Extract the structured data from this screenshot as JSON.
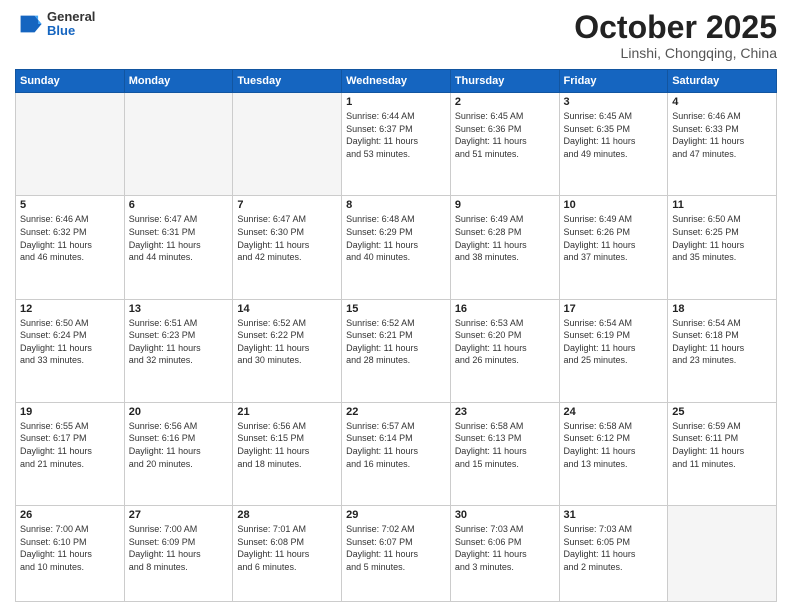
{
  "header": {
    "logo_general": "General",
    "logo_blue": "Blue",
    "month_title": "October 2025",
    "location": "Linshi, Chongqing, China"
  },
  "weekdays": [
    "Sunday",
    "Monday",
    "Tuesday",
    "Wednesday",
    "Thursday",
    "Friday",
    "Saturday"
  ],
  "weeks": [
    [
      {
        "day": "",
        "info": ""
      },
      {
        "day": "",
        "info": ""
      },
      {
        "day": "",
        "info": ""
      },
      {
        "day": "1",
        "info": "Sunrise: 6:44 AM\nSunset: 6:37 PM\nDaylight: 11 hours\nand 53 minutes."
      },
      {
        "day": "2",
        "info": "Sunrise: 6:45 AM\nSunset: 6:36 PM\nDaylight: 11 hours\nand 51 minutes."
      },
      {
        "day": "3",
        "info": "Sunrise: 6:45 AM\nSunset: 6:35 PM\nDaylight: 11 hours\nand 49 minutes."
      },
      {
        "day": "4",
        "info": "Sunrise: 6:46 AM\nSunset: 6:33 PM\nDaylight: 11 hours\nand 47 minutes."
      }
    ],
    [
      {
        "day": "5",
        "info": "Sunrise: 6:46 AM\nSunset: 6:32 PM\nDaylight: 11 hours\nand 46 minutes."
      },
      {
        "day": "6",
        "info": "Sunrise: 6:47 AM\nSunset: 6:31 PM\nDaylight: 11 hours\nand 44 minutes."
      },
      {
        "day": "7",
        "info": "Sunrise: 6:47 AM\nSunset: 6:30 PM\nDaylight: 11 hours\nand 42 minutes."
      },
      {
        "day": "8",
        "info": "Sunrise: 6:48 AM\nSunset: 6:29 PM\nDaylight: 11 hours\nand 40 minutes."
      },
      {
        "day": "9",
        "info": "Sunrise: 6:49 AM\nSunset: 6:28 PM\nDaylight: 11 hours\nand 38 minutes."
      },
      {
        "day": "10",
        "info": "Sunrise: 6:49 AM\nSunset: 6:26 PM\nDaylight: 11 hours\nand 37 minutes."
      },
      {
        "day": "11",
        "info": "Sunrise: 6:50 AM\nSunset: 6:25 PM\nDaylight: 11 hours\nand 35 minutes."
      }
    ],
    [
      {
        "day": "12",
        "info": "Sunrise: 6:50 AM\nSunset: 6:24 PM\nDaylight: 11 hours\nand 33 minutes."
      },
      {
        "day": "13",
        "info": "Sunrise: 6:51 AM\nSunset: 6:23 PM\nDaylight: 11 hours\nand 32 minutes."
      },
      {
        "day": "14",
        "info": "Sunrise: 6:52 AM\nSunset: 6:22 PM\nDaylight: 11 hours\nand 30 minutes."
      },
      {
        "day": "15",
        "info": "Sunrise: 6:52 AM\nSunset: 6:21 PM\nDaylight: 11 hours\nand 28 minutes."
      },
      {
        "day": "16",
        "info": "Sunrise: 6:53 AM\nSunset: 6:20 PM\nDaylight: 11 hours\nand 26 minutes."
      },
      {
        "day": "17",
        "info": "Sunrise: 6:54 AM\nSunset: 6:19 PM\nDaylight: 11 hours\nand 25 minutes."
      },
      {
        "day": "18",
        "info": "Sunrise: 6:54 AM\nSunset: 6:18 PM\nDaylight: 11 hours\nand 23 minutes."
      }
    ],
    [
      {
        "day": "19",
        "info": "Sunrise: 6:55 AM\nSunset: 6:17 PM\nDaylight: 11 hours\nand 21 minutes."
      },
      {
        "day": "20",
        "info": "Sunrise: 6:56 AM\nSunset: 6:16 PM\nDaylight: 11 hours\nand 20 minutes."
      },
      {
        "day": "21",
        "info": "Sunrise: 6:56 AM\nSunset: 6:15 PM\nDaylight: 11 hours\nand 18 minutes."
      },
      {
        "day": "22",
        "info": "Sunrise: 6:57 AM\nSunset: 6:14 PM\nDaylight: 11 hours\nand 16 minutes."
      },
      {
        "day": "23",
        "info": "Sunrise: 6:58 AM\nSunset: 6:13 PM\nDaylight: 11 hours\nand 15 minutes."
      },
      {
        "day": "24",
        "info": "Sunrise: 6:58 AM\nSunset: 6:12 PM\nDaylight: 11 hours\nand 13 minutes."
      },
      {
        "day": "25",
        "info": "Sunrise: 6:59 AM\nSunset: 6:11 PM\nDaylight: 11 hours\nand 11 minutes."
      }
    ],
    [
      {
        "day": "26",
        "info": "Sunrise: 7:00 AM\nSunset: 6:10 PM\nDaylight: 11 hours\nand 10 minutes."
      },
      {
        "day": "27",
        "info": "Sunrise: 7:00 AM\nSunset: 6:09 PM\nDaylight: 11 hours\nand 8 minutes."
      },
      {
        "day": "28",
        "info": "Sunrise: 7:01 AM\nSunset: 6:08 PM\nDaylight: 11 hours\nand 6 minutes."
      },
      {
        "day": "29",
        "info": "Sunrise: 7:02 AM\nSunset: 6:07 PM\nDaylight: 11 hours\nand 5 minutes."
      },
      {
        "day": "30",
        "info": "Sunrise: 7:03 AM\nSunset: 6:06 PM\nDaylight: 11 hours\nand 3 minutes."
      },
      {
        "day": "31",
        "info": "Sunrise: 7:03 AM\nSunset: 6:05 PM\nDaylight: 11 hours\nand 2 minutes."
      },
      {
        "day": "",
        "info": ""
      }
    ]
  ]
}
